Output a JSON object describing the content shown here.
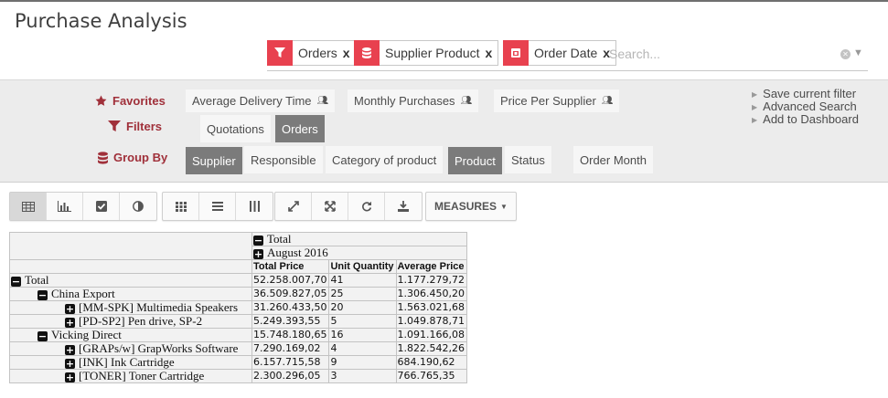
{
  "page_title": "Purchase Analysis",
  "search": {
    "facets": [
      {
        "icon": "filter-icon",
        "label": "Orders",
        "remove": "x"
      },
      {
        "icon": "database-icon",
        "label": "Supplier  Product",
        "remove": "x"
      },
      {
        "icon": "calendar-icon",
        "label": "Order Date",
        "remove": "x"
      }
    ],
    "placeholder": "Search..."
  },
  "panel": {
    "favorites_label": "Favorites",
    "filters_label": "Filters",
    "groupby_label": "Group By",
    "favorites": [
      "Average Delivery Time",
      "Monthly Purchases",
      "Price Per Supplier"
    ],
    "filters": [
      {
        "label": "Quotations",
        "selected": false
      },
      {
        "label": "Orders",
        "selected": true
      }
    ],
    "groupby": [
      {
        "label": "Supplier",
        "selected": true
      },
      {
        "label": "Responsible",
        "selected": false
      },
      {
        "label": "Category of product",
        "selected": false
      },
      {
        "label": "Product",
        "selected": true
      },
      {
        "label": "Status",
        "selected": false
      },
      {
        "label": "Order Month",
        "selected": false
      }
    ],
    "links": [
      "Save current filter",
      "Advanced Search",
      "Add to Dashboard"
    ]
  },
  "toolbar": {
    "view_buttons": [
      "table-icon",
      "bar-chart-icon",
      "check-square-icon",
      "half-circle-icon"
    ],
    "layout_buttons": [
      "grid-icon",
      "list-icon",
      "columns-icon"
    ],
    "action_buttons": [
      "expand-icon",
      "fullscreen-icon",
      "refresh-icon",
      "download-icon"
    ],
    "measures_label": "MEASURES"
  },
  "pivot": {
    "col_total": "Total",
    "col_period": "August 2016",
    "measures": [
      "Total Price",
      "Unit Quantity",
      "Average Price"
    ],
    "rows": [
      {
        "level": 0,
        "toggle": "minus",
        "label": "Total",
        "values": [
          "52.258.007,70",
          "41",
          "1.177.279,72"
        ]
      },
      {
        "level": 1,
        "toggle": "minus",
        "label": "China Export",
        "values": [
          "36.509.827,05",
          "25",
          "1.306.450,20"
        ]
      },
      {
        "level": 2,
        "toggle": "plus",
        "label": "[MM-SPK] Multimedia Speakers",
        "values": [
          "31.260.433,50",
          "20",
          "1.563.021,68"
        ]
      },
      {
        "level": 2,
        "toggle": "plus",
        "label": "[PD-SP2] Pen drive, SP-2",
        "values": [
          "5.249.393,55",
          "5",
          "1.049.878,71"
        ]
      },
      {
        "level": 1,
        "toggle": "minus",
        "label": "Vicking Direct",
        "values": [
          "15.748.180,65",
          "16",
          "1.091.166,08"
        ]
      },
      {
        "level": 2,
        "toggle": "plus",
        "label": "[GRAPs/w] GrapWorks Software",
        "values": [
          "7.290.169,02",
          "4",
          "1.822.542,26"
        ]
      },
      {
        "level": 2,
        "toggle": "plus",
        "label": "[INK] Ink Cartridge",
        "values": [
          "6.157.715,58",
          "9",
          "684.190,62"
        ]
      },
      {
        "level": 2,
        "toggle": "plus",
        "label": "[TONER] Toner Cartridge",
        "values": [
          "2.300.296,05",
          "3",
          "766.765,35"
        ]
      }
    ]
  },
  "colors": {
    "accent": "#e8414f",
    "label_red": "#a0303a",
    "selected_bg": "#7b7b7b"
  }
}
